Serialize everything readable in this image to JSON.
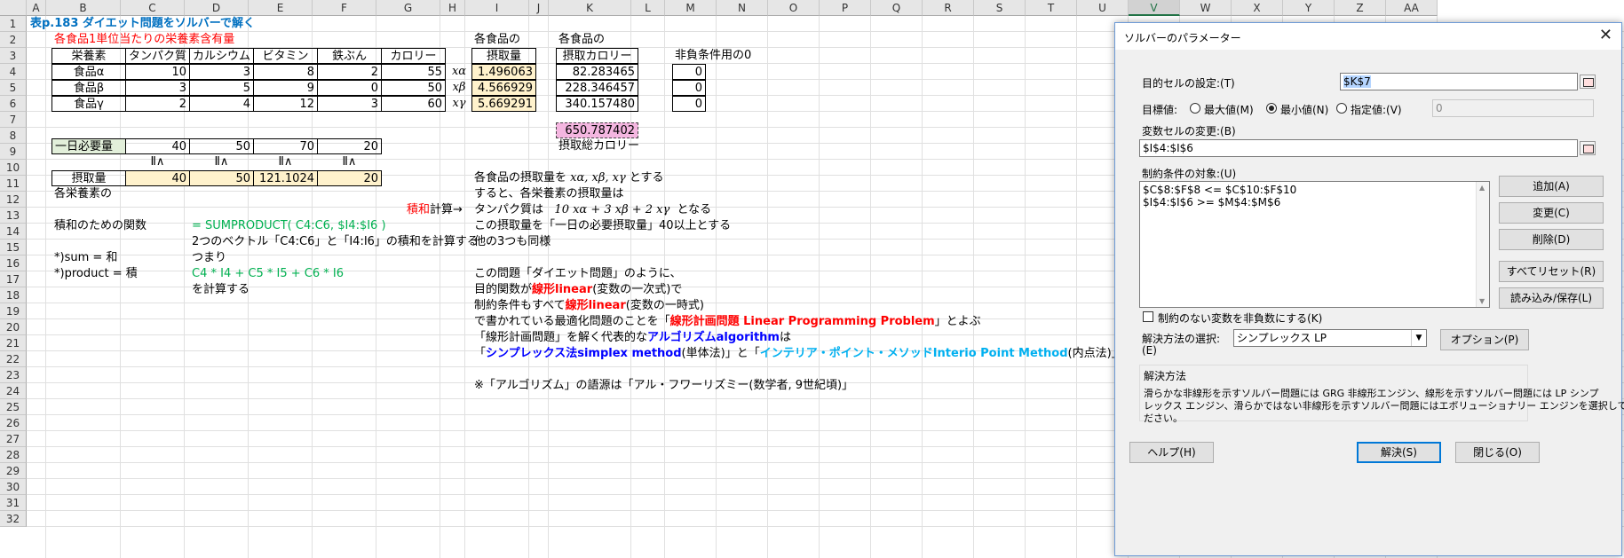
{
  "columns": [
    "A",
    "B",
    "C",
    "D",
    "E",
    "F",
    "G",
    "H",
    "I",
    "J",
    "K",
    "L",
    "M",
    "N",
    "O",
    "P",
    "Q",
    "R",
    "S",
    "T",
    "U",
    "V",
    "W",
    "X",
    "Y",
    "Z",
    "AA"
  ],
  "rows": [
    "1",
    "2",
    "3",
    "4",
    "5",
    "6",
    "7",
    "8",
    "9",
    "10",
    "11",
    "12",
    "13",
    "14",
    "15",
    "16",
    "17",
    "18",
    "19",
    "20",
    "21",
    "22",
    "23",
    "24",
    "25",
    "26",
    "27",
    "28",
    "29",
    "30",
    "31",
    "32"
  ],
  "sheet": {
    "title": "表p.183 ダイエット問題をソルバーで解く",
    "subtitle": "各食品1単位当たりの栄養素含有量",
    "headers": [
      "栄養素",
      "タンパク質",
      "カルシウム",
      "ビタミン",
      "鉄ぶん",
      "カロリー"
    ],
    "foods": [
      {
        "name": "食品α",
        "v": [
          "10",
          "3",
          "8",
          "2",
          "55"
        ],
        "var": "xα",
        "amount": "1.496063",
        "cal": "82.283465",
        "zero": "0"
      },
      {
        "name": "食品β",
        "v": [
          "3",
          "5",
          "9",
          "0",
          "50"
        ],
        "var": "xβ",
        "amount": "4.566929",
        "cal": "228.346457",
        "zero": "0"
      },
      {
        "name": "食品γ",
        "v": [
          "2",
          "4",
          "12",
          "3",
          "60"
        ],
        "var": "xγ",
        "amount": "5.669291",
        "cal": "340.157480",
        "zero": "0"
      }
    ],
    "i2": "各食品の",
    "i3": "摂取量",
    "k2": "各食品の",
    "k3": "摂取カロリー",
    "m3": "非負条件用の0",
    "total_cal": "650.787402",
    "total_cal_label": "摂取総カロリー",
    "req_label": "一日必要量",
    "req": [
      "40",
      "50",
      "70",
      "20"
    ],
    "ge": "Ⅱ∧",
    "intake_label": "摂取量",
    "intake": [
      "40",
      "50",
      "121.1024",
      "20"
    ],
    "b11": "各栄養素の",
    "g12": "積和",
    "g12b": "計算→",
    "b13": "積和のための関数",
    "d13": "= SUMPRODUCT( C4:C6, $I4:$I6 )",
    "d14": "2つのベクトル「C4:C6」と「I4:I6」の積和を計算する",
    "b15": "*)sum = 和",
    "d15": "つまり",
    "b16": "*)product = 積",
    "d16": "C4 * I4 + C5 * I5 + C6 * I6",
    "d17": "を計算する",
    "t10a": "各食品の摂取量を",
    "t10vars": "xα, xβ, xγ",
    "t10b": "とする",
    "t11": "すると、各栄養素の摂取量は",
    "t12a": "タンパク質は",
    "t12expr": "10 xα + 3 xβ + 2 xγ",
    "t12b": "となる",
    "t13": "この摂取量を「一日の必要摂取量」40以上とする",
    "t14": "他の3つも同様",
    "t16": "この問題「ダイエット問題」のように、",
    "t17a": "目的関数が",
    "t17b": "線形linear",
    "t17c": "(変数の一次式)で",
    "t18a": "制約条件もすべて",
    "t18b": "線形linear",
    "t18c": "(変数の一時式)",
    "t19a": "で書かれている最適化問題のことを「",
    "t19b": "線形計画問題 Linear Programming Problem",
    "t19c": "」とよぶ",
    "t20a": "「線形計画問題」を解く代表的な",
    "t20b": "アルゴリズムalgorithm",
    "t20c": "は",
    "t21a": "「",
    "t21b": "シンプレックス法simplex method",
    "t21c": "(単体法)」と「",
    "t21d": "インテリア・ポイント・メソッドInterio Point Method",
    "t21e": "(内点法)」",
    "t23": "※「アルゴリズム」の語源は「アル・フワーリズミー(数学者, 9世紀頃)」"
  },
  "dialog": {
    "title": "ソルバーのパラメーター",
    "close": "✕",
    "target_label": "目的セルの設定:(T)",
    "target_value": "$K$7",
    "goal_label": "目標値:",
    "opt_max": "最大値(M)",
    "opt_min": "最小値(N)",
    "opt_val": "指定値:(V)",
    "opt_val_value": "0",
    "vars_label": "変数セルの変更:(B)",
    "vars_value": "$I$4:$I$6",
    "cons_label": "制約条件の対象:(U)",
    "constraints": [
      "$C$8:$F$8 <= $C$10:$F$10",
      "$I$4:$I$6 >= $M$4:$M$6"
    ],
    "btn_add": "追加(A)",
    "btn_change": "変更(C)",
    "btn_delete": "削除(D)",
    "btn_reset": "すべてリセット(R)",
    "btn_load": "読み込み/保存(L)",
    "nonneg_label": "制約のない変数を非負数にする(K)",
    "method_label": "解決方法の選択:",
    "method_label2": "(E)",
    "method_value": "シンプレックス LP",
    "btn_options": "オプション(P)",
    "group_title": "解決方法",
    "group_text1": "滑らかな非線形を示すソルバー問題には GRG 非線形エンジン、線形を示すソルバー問題には LP シンプ",
    "group_text2": "レックス エンジン、滑らかではない非線形を示すソルバー問題にはエボリューショナリー エンジンを選択してく",
    "group_text3": "ださい。",
    "btn_help": "ヘルプ(H)",
    "btn_solve": "解決(S)",
    "btn_close": "閉じる(O)"
  }
}
